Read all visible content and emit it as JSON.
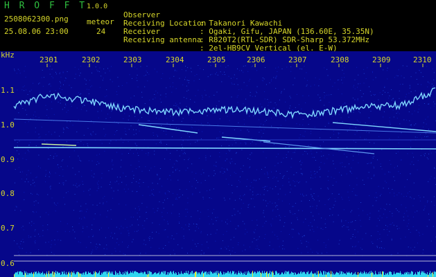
{
  "app": {
    "title": "H R O F F T",
    "version": "1.0.0"
  },
  "file": {
    "name": "2508062300.png",
    "datetime": "25.08.06 23:00"
  },
  "meteor": {
    "label": "meteor",
    "count": "24"
  },
  "info": [
    {
      "key": "Observer",
      "value": ": Takanori Kawachi"
    },
    {
      "key": "Receiving Location",
      "value": ": Ogaki, Gifu, JAPAN (136.60E, 35.35N)"
    },
    {
      "key": "Receiver",
      "value": ": R820T2(RTL-SDR) SDR-Sharp 53.372MHz"
    },
    {
      "key": "Receiving antenna",
      "value": ": 2el-HB9CV Vertical (el. E-W)"
    }
  ],
  "axis": {
    "unit": "kHz",
    "time_ticks": [
      "2301",
      "2302",
      "2303",
      "2304",
      "2305",
      "2306",
      "2307",
      "2308",
      "2309",
      "2310"
    ],
    "freq_ticks": [
      "1.1",
      "1.0",
      "0.9",
      "0.8",
      "0.7",
      "0.6"
    ]
  },
  "colors": {
    "background": "#06078a",
    "title": "#2fbf3f",
    "text": "#d7d72a",
    "signal": "#7fd6ff",
    "signal_bright": "#c8f0a0",
    "baseline": "#2fd5f0"
  }
}
